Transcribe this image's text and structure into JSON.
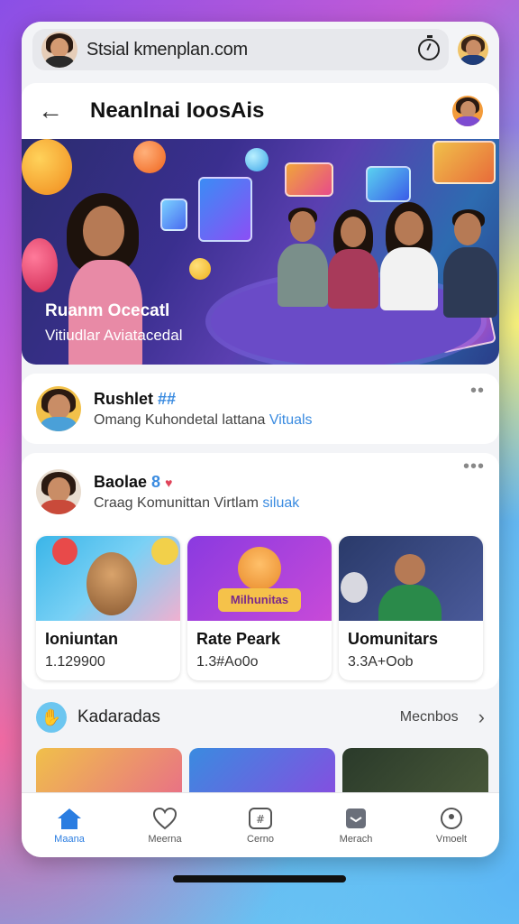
{
  "browser": {
    "url": "Stsial kmenplan.com"
  },
  "header": {
    "title": "Neanlnai IoosAis"
  },
  "hero": {
    "title": "Ruanm Ocecatl",
    "subtitle": "Vitiudlar Aviatacedal"
  },
  "profiles": [
    {
      "name": "Rushlet",
      "tag": "##",
      "desc_prefix": "Omang Kuhondetal lattana ",
      "desc_highlight": "Vituals"
    },
    {
      "name": "Baolae",
      "tag": "8",
      "desc_prefix": "Craag Komunittan Virtlam ",
      "desc_highlight": "siluak"
    }
  ],
  "tiles": [
    {
      "title": "Ioniuntan",
      "sub": "1.129900"
    },
    {
      "title": "Rate Peark",
      "sub": "1.3#Ao0o"
    },
    {
      "title": "Uomunitars",
      "sub": "3.3A+Oob"
    }
  ],
  "tile_logo_text": "Milhunitas",
  "section": {
    "title": "Kadaradas",
    "more": "Mecnbos"
  },
  "nav": [
    {
      "label": "Maana",
      "icon": "home-icon"
    },
    {
      "label": "Meerna",
      "icon": "heart-icon"
    },
    {
      "label": "Cerno",
      "icon": "grid-icon"
    },
    {
      "label": "Merach",
      "icon": "inbox-icon"
    },
    {
      "label": "Vmoelt",
      "icon": "profile-icon"
    }
  ],
  "colors": {
    "accent": "#2a7de1",
    "highlight": "#3a8be0"
  }
}
